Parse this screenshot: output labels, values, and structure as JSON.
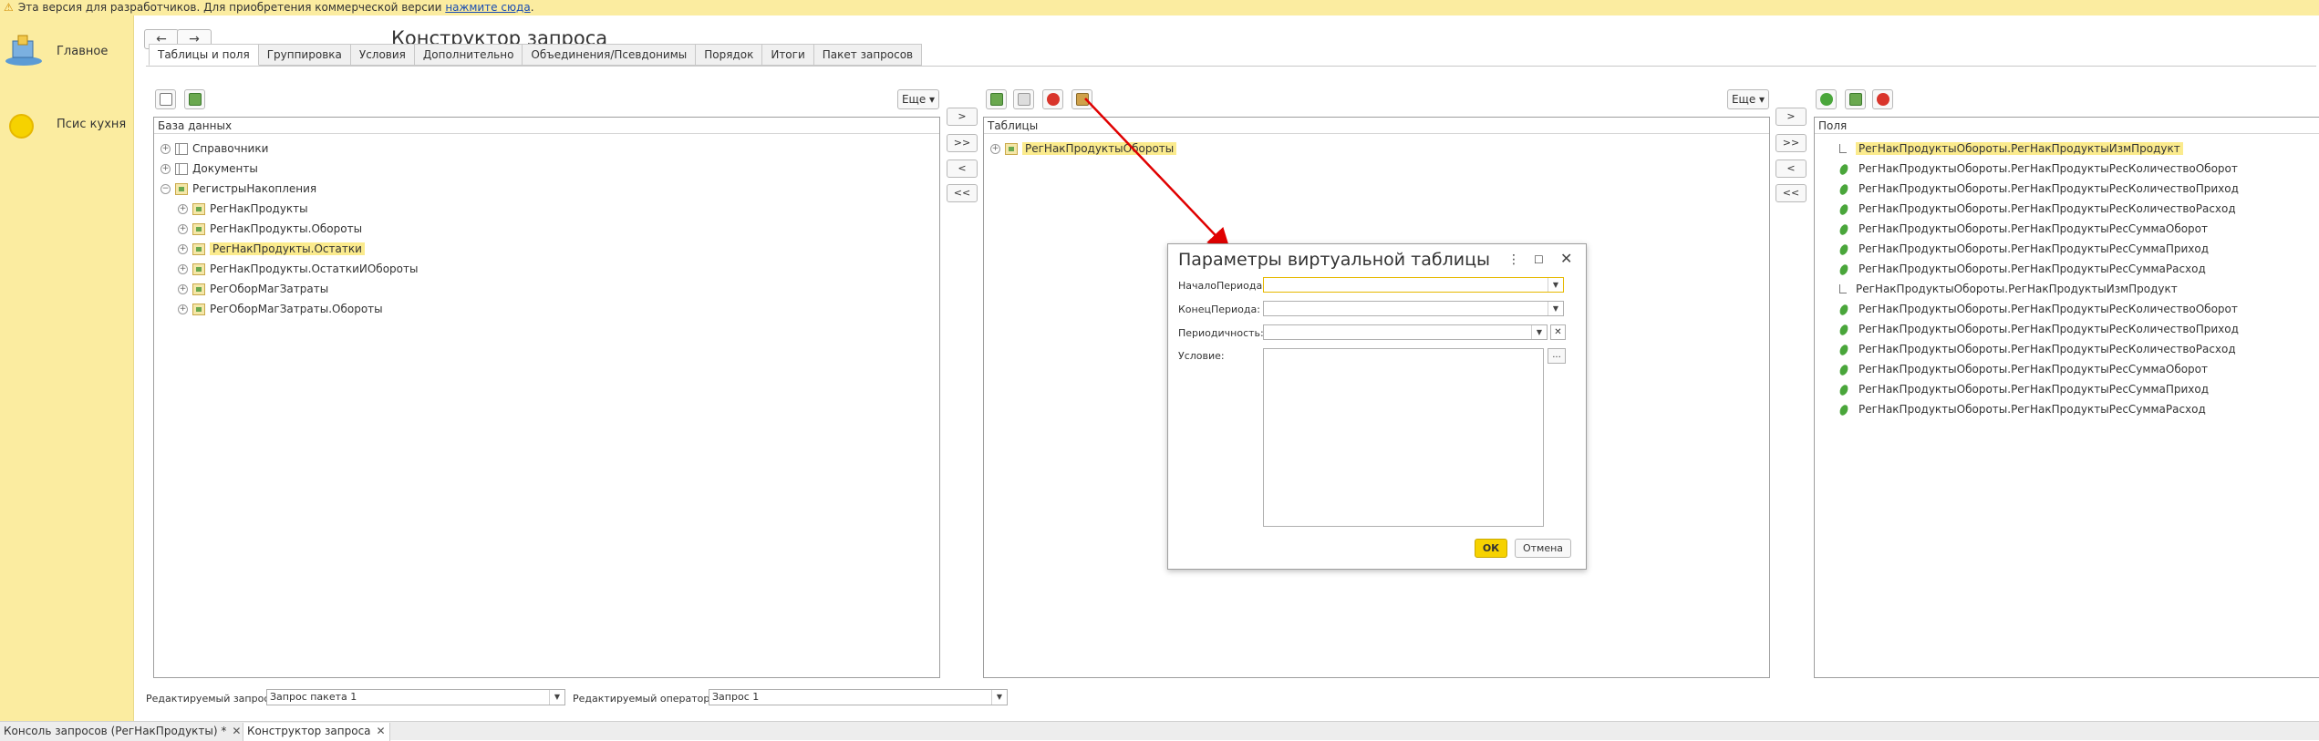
{
  "banner": {
    "text": "Эта версия для разработчиков. Для приобретения коммерческой версии",
    "link": "нажмите сюда",
    "suffix": "."
  },
  "sidebar": {
    "items": [
      {
        "label": "Главное",
        "icon": "home-icon"
      },
      {
        "label": "Псис кухня",
        "icon": "section-icon"
      }
    ]
  },
  "nav": {
    "back": "←",
    "forward": "→"
  },
  "title": "Конструктор запроса",
  "tabs": [
    "Таблицы и поля",
    "Группировка",
    "Условия",
    "Дополнительно",
    "Объединения/Псевдонимы",
    "Порядок",
    "Итоги",
    "Пакет запросов"
  ],
  "panels": {
    "db": {
      "header": "База данных",
      "more": "Еще ▾"
    },
    "tables": {
      "header": "Таблицы",
      "more": "Еще ▾"
    },
    "fields": {
      "header": "Поля"
    }
  },
  "move_buttons": [
    ">",
    ">>",
    "<",
    "<<"
  ],
  "db_tree": [
    {
      "label": "Справочники",
      "level": 0,
      "icon": "table-icon",
      "expand": "+"
    },
    {
      "label": "Документы",
      "level": 0,
      "icon": "document-icon",
      "expand": "+"
    },
    {
      "label": "РегистрыНакопления",
      "level": 0,
      "icon": "register-icon",
      "expand": "−"
    },
    {
      "label": "РегНакПродукты",
      "level": 1,
      "icon": "register-icon",
      "expand": "+"
    },
    {
      "label": "РегНакПродукты.Обороты",
      "level": 1,
      "icon": "register-icon",
      "expand": "+"
    },
    {
      "label": "РегНакПродукты.Остатки",
      "level": 1,
      "icon": "register-icon",
      "expand": "+",
      "highlight": true
    },
    {
      "label": "РегНакПродукты.ОстаткиИОбороты",
      "level": 1,
      "icon": "register-icon",
      "expand": "+"
    },
    {
      "label": "РегОборМагЗатраты",
      "level": 1,
      "icon": "register-icon",
      "expand": "+"
    },
    {
      "label": "РегОборМагЗатраты.Обороты",
      "level": 1,
      "icon": "register-icon",
      "expand": "+"
    }
  ],
  "tables_tree": [
    {
      "label": "РегНакПродуктыОбороты",
      "highlight": true
    }
  ],
  "fields": [
    {
      "label": "РегНакПродуктыОбороты.РегНакПродуктыИзмПродукт",
      "kind": "dimension",
      "highlight": true
    },
    {
      "label": "РегНакПродуктыОбороты.РегНакПродуктыРесКоличествоОборот",
      "kind": "resource"
    },
    {
      "label": "РегНакПродуктыОбороты.РегНакПродуктыРесКоличествоПриход",
      "kind": "resource"
    },
    {
      "label": "РегНакПродуктыОбороты.РегНакПродуктыРесКоличествоРасход",
      "kind": "resource"
    },
    {
      "label": "РегНакПродуктыОбороты.РегНакПродуктыРесСуммаОборот",
      "kind": "resource"
    },
    {
      "label": "РегНакПродуктыОбороты.РегНакПродуктыРесСуммаПриход",
      "kind": "resource"
    },
    {
      "label": "РегНакПродуктыОбороты.РегНакПродуктыРесСуммаРасход",
      "kind": "resource"
    },
    {
      "label": "РегНакПродуктыОбороты.РегНакПродуктыИзмПродукт",
      "kind": "dimension"
    },
    {
      "label": "РегНакПродуктыОбороты.РегНакПродуктыРесКоличествоОборот",
      "kind": "resource"
    },
    {
      "label": "РегНакПродуктыОбороты.РегНакПродуктыРесКоличествоПриход",
      "kind": "resource"
    },
    {
      "label": "РегНакПродуктыОбороты.РегНакПродуктыРесКоличествоРасход",
      "kind": "resource"
    },
    {
      "label": "РегНакПродуктыОбороты.РегНакПродуктыРесСуммаОборот",
      "kind": "resource"
    },
    {
      "label": "РегНакПродуктыОбороты.РегНакПродуктыРесСуммаПриход",
      "kind": "resource"
    },
    {
      "label": "РегНакПродуктыОбороты.РегНакПродуктыРесСуммаРасход",
      "kind": "resource"
    }
  ],
  "dialog": {
    "title": "Параметры виртуальной таблицы",
    "labels": {
      "start": "НачалоПериода:",
      "end": "КонецПериода:",
      "periodicity": "Периодичность:",
      "condition": "Условие:"
    },
    "values": {
      "start": "",
      "end": "",
      "periodicity": "",
      "condition": ""
    },
    "ok": "ОК",
    "cancel": "Отмена",
    "ellipsis": "..."
  },
  "bottom": {
    "query_label": "Редактируемый запрос:",
    "query_value": "Запрос пакета 1",
    "operator_label": "Редактируемый оператор:",
    "operator_value": "Запрос 1"
  },
  "window_tabs": [
    {
      "label": "Консоль запросов (РегНакПродукты) *"
    },
    {
      "label": "Конструктор запроса"
    }
  ],
  "colors": {
    "accent": "#f6d200",
    "highlight": "#fbeb8d",
    "banner": "#fbeca0",
    "arrow": "#e00000"
  }
}
